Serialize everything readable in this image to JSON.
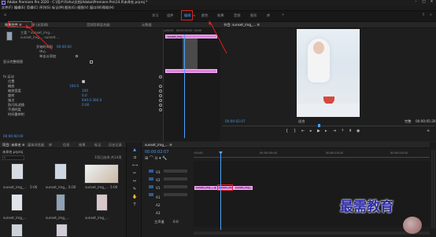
{
  "window": {
    "title": "Adobe Premiere Pro 2020 - C:\\用户\\Yizhu\\文档\\Adobe\\Premiere Pro\\14.0\\未命名.prproj *"
  },
  "menubar": [
    "文件(F)",
    "编辑(E)",
    "剪辑(C)",
    "序列(S)",
    "标记(M)",
    "图形(G)",
    "视图(V)",
    "窗口(W)",
    "帮助(H)"
  ],
  "workspaces": {
    "items": [
      "学习",
      "组件",
      "编辑",
      "颜色",
      "效果",
      "音频",
      "图形",
      "库"
    ],
    "active": "编辑"
  },
  "effect_controls": {
    "tabs": [
      "效果控件 ≡",
      "源:(无剪辑)",
      "音频剪辑混合器:",
      "元数据"
    ],
    "source_label": "主要 * sunset_img...",
    "seq_label": "sunset_img ... sunset ...",
    "clip_bar": "sunset_img_...",
    "timecode_head": "00:00:00:00",
    "rows": [
      {
        "label": "开始时间码",
        "value": "00:00:00"
      },
      {
        "label": "中心",
        "value": ""
      },
      {
        "label": "单击以添加",
        "value": ""
      },
      {
        "label": "显示完整视图",
        "value": ""
      }
    ],
    "motion": {
      "label": "fx 运动",
      "subrows": [
        {
          "label": "位置",
          "value": "320.0  450.0"
        },
        {
          "label": "缩放",
          "value": "100.0"
        },
        {
          "label": "缩放宽度",
          "value": "100"
        },
        {
          "label": "旋转",
          "value": "0.0"
        },
        {
          "label": "锚点",
          "value": "640.0  360.0"
        },
        {
          "label": "防闪烁滤镜",
          "value": "0.00"
        },
        {
          "label": "不透明度",
          "value": ""
        },
        {
          "label": "时间重映射",
          "value": ""
        }
      ]
    },
    "bottom_tc": "00:00:00:00"
  },
  "program": {
    "tab": "节目: sunset_img_... ≡",
    "timecode": "00:00:02:07",
    "fit": "适合",
    "scale": "完整",
    "duration": "00:00:05:20"
  },
  "project": {
    "tabs": [
      "项目: 未命名 ≡",
      "媒体浏览器",
      "库",
      "信息",
      "效果",
      "标记",
      "历史记录"
    ],
    "name": "未命名.prproj",
    "count": "1项已选择,共14项",
    "items": [
      {
        "name": "sunset_img_...",
        "dur": "5:00"
      },
      {
        "name": "sunset_img_...",
        "dur": "5:00"
      },
      {
        "name": "sunset_img_...",
        "dur": "5:00"
      },
      {
        "name": "sunset_img_...",
        "dur": "5:00"
      },
      {
        "name": "sunset_img_...",
        "dur": "5:00"
      },
      {
        "name": "sunset_img_...",
        "dur": "5:00"
      },
      {
        "name": "sunset_img_...",
        "dur": "5:00"
      },
      {
        "name": "sunset_img_...",
        "dur": "5:00"
      }
    ]
  },
  "timeline": {
    "tab": "sunset_img_... ≡",
    "timecode": "00:00:02:07",
    "ruler": [
      ":00:00",
      "00:00:05:00",
      "00:00:10:00",
      "00:00:15:00"
    ],
    "tracks": [
      "V3",
      "V2",
      "V1",
      "A1",
      "A2",
      "A3",
      "主声道"
    ],
    "master_val": "0.0",
    "clips": {
      "v1_left": "sunset_img_...jpg",
      "v1_mid": "sunset_img",
      "v1_right": "sunset_img_...jpg"
    }
  },
  "watermark": "最需教育",
  "colors": {
    "accent": "#4aa3ff",
    "clip": "#e07ee0",
    "annot": "#e02020"
  }
}
